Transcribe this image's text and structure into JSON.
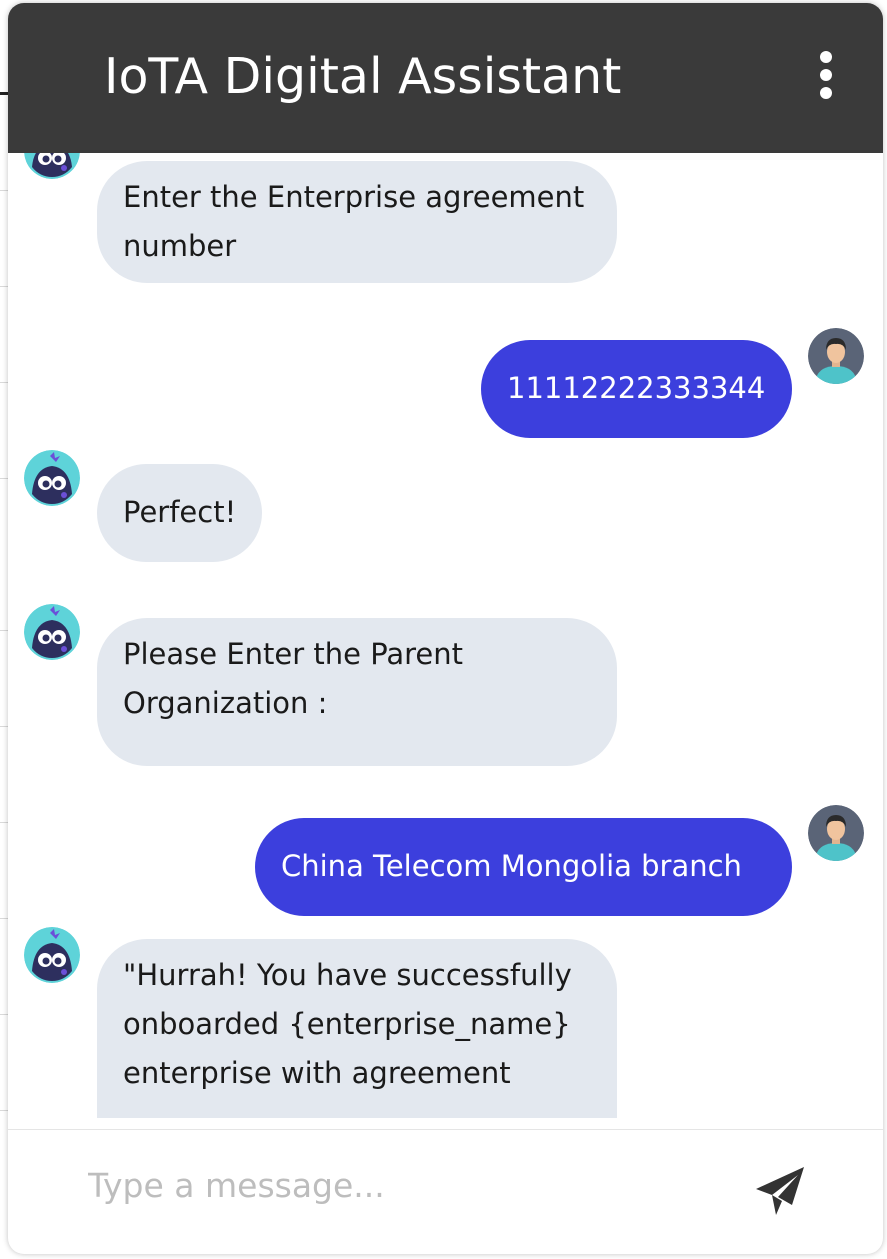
{
  "header": {
    "title": "IoTA Digital Assistant",
    "menu_icon": "more-vertical-icon"
  },
  "messages": [
    {
      "sender": "bot",
      "text": "Enter the Enterprise agreement number"
    },
    {
      "sender": "user",
      "text": "11112222333344"
    },
    {
      "sender": "bot",
      "text": "Perfect!"
    },
    {
      "sender": "bot",
      "text": "Please Enter the Parent Organization :"
    },
    {
      "sender": "user",
      "text": "China Telecom Mongolia branch"
    },
    {
      "sender": "bot",
      "text": "\"Hurrah! You have successfully onboarded {enterprise_name} enterprise with agreement"
    }
  ],
  "composer": {
    "placeholder": "Type a message...",
    "value": "",
    "send_icon": "send-icon"
  },
  "colors": {
    "header_bg": "#3a3a3a",
    "bot_bubble": "#e3e8ef",
    "user_bubble": "#3c3fdd",
    "bot_avatar_bg": "#5ed3d9",
    "user_avatar_bg": "#5a6477"
  }
}
